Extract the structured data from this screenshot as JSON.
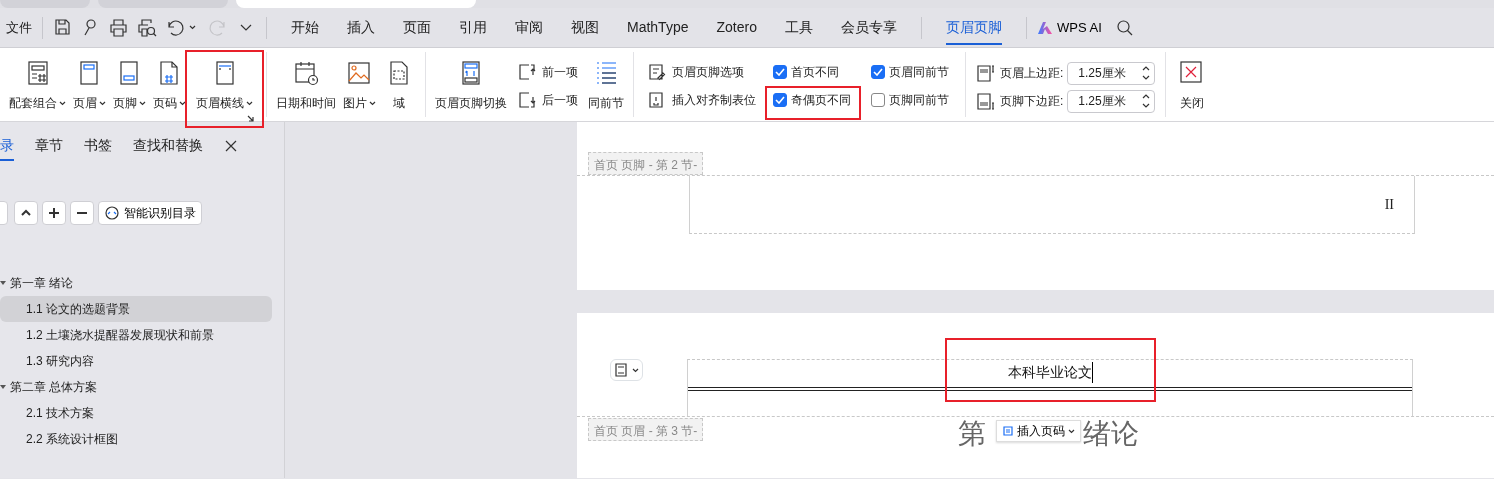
{
  "window_tabs": [
    {
      "selected": false
    },
    {
      "selected": false
    },
    {
      "selected": true
    }
  ],
  "file_menu": "文件",
  "redo_disabled": true,
  "ribbon_tabs": [
    {
      "label": "开始",
      "selected": false
    },
    {
      "label": "插入",
      "selected": false
    },
    {
      "label": "页面",
      "selected": false
    },
    {
      "label": "引用",
      "selected": false
    },
    {
      "label": "审阅",
      "selected": false
    },
    {
      "label": "视图",
      "selected": false
    },
    {
      "label": "MathType",
      "selected": false
    },
    {
      "label": "Zotero",
      "selected": false
    },
    {
      "label": "工具",
      "selected": false
    },
    {
      "label": "会员专享",
      "selected": false
    },
    {
      "label": "页眉页脚",
      "selected": true
    }
  ],
  "wps_ai": "WPS AI",
  "ribbon_groups": [
    {
      "items": [
        {
          "kind": "large",
          "label": "配套组合",
          "dropdown": true,
          "highlighted": false
        },
        {
          "kind": "large",
          "label": "页眉",
          "dropdown": true,
          "highlighted": false
        },
        {
          "kind": "large",
          "label": "页脚",
          "dropdown": true,
          "highlighted": false
        },
        {
          "kind": "large",
          "label": "页码",
          "dropdown": true,
          "highlighted": false
        },
        {
          "kind": "large",
          "label": "页眉横线",
          "dropdown": true,
          "launcher": true,
          "highlighted": true
        }
      ]
    },
    {
      "items": [
        {
          "kind": "large",
          "label": "日期和时间",
          "dropdown": false,
          "highlighted": false
        },
        {
          "kind": "large",
          "label": "图片",
          "dropdown": true,
          "highlighted": false
        },
        {
          "kind": "large",
          "label": "域",
          "dropdown": false,
          "highlighted": false
        }
      ]
    },
    {
      "items": [
        {
          "kind": "large",
          "label": "页眉页脚切换",
          "dropdown": false,
          "highlighted": false
        },
        {
          "kind": "stack",
          "buttons": [
            {
              "label": "前一项"
            },
            {
              "label": "后一项"
            }
          ]
        },
        {
          "kind": "large",
          "label": "同前节",
          "dropdown": false,
          "highlighted": false
        }
      ]
    },
    {
      "items": [
        {
          "kind": "stack",
          "buttons": [
            {
              "label": "页眉页脚选项"
            },
            {
              "label": "插入对齐制表位"
            }
          ]
        },
        {
          "kind": "checks",
          "checks": [
            {
              "label": "首页不同",
              "checked": true,
              "highlighted": false
            },
            {
              "label": "奇偶页不同",
              "checked": true,
              "highlighted": true
            }
          ]
        },
        {
          "kind": "checks",
          "checks": [
            {
              "label": "页眉同前节",
              "checked": true,
              "highlighted": false
            },
            {
              "label": "页脚同前节",
              "checked": false,
              "highlighted": false
            }
          ]
        }
      ]
    },
    {
      "items": [
        {
          "kind": "spinners",
          "spinners": [
            {
              "label": "页眉上边距:",
              "value": "1.25厘米"
            },
            {
              "label": "页脚下边距:",
              "value": "1.25厘米"
            }
          ]
        }
      ]
    },
    {
      "items": [
        {
          "kind": "large",
          "label": "关闭",
          "dropdown": false,
          "highlighted": false
        }
      ]
    }
  ],
  "nav_panel": {
    "tabs": [
      {
        "label": "录",
        "selected": true
      },
      {
        "label": "章节",
        "selected": false
      },
      {
        "label": "书签",
        "selected": false
      },
      {
        "label": "查找和替换",
        "selected": false
      }
    ],
    "smart_toc_button": "智能识别目录",
    "outline": [
      {
        "label": "第一章  绪论",
        "expanded": true,
        "selected": false,
        "children": [
          {
            "label": "1.1 论文的选题背景",
            "selected": true
          },
          {
            "label": "1.2 土壤浇水提醒器发展现状和前景",
            "selected": false
          },
          {
            "label": "1.3 研究内容",
            "selected": false
          }
        ]
      },
      {
        "label": "第二章 总体方案",
        "expanded": true,
        "selected": false,
        "children": [
          {
            "label": "2.1 技术方案",
            "selected": false
          },
          {
            "label": "2.2 系统设计框图",
            "selected": false
          }
        ]
      }
    ]
  },
  "document": {
    "footer_tag": "首页 页脚  - 第 2 节-",
    "footer_page_number": "II",
    "header_text": "本科毕业论文",
    "header_highlighted": true,
    "header_line": true,
    "header_tag": "首页 页眉  - 第 3 节-",
    "heading_parts": [
      "第",
      "绪论"
    ],
    "insert_page_number": "插入页码"
  }
}
